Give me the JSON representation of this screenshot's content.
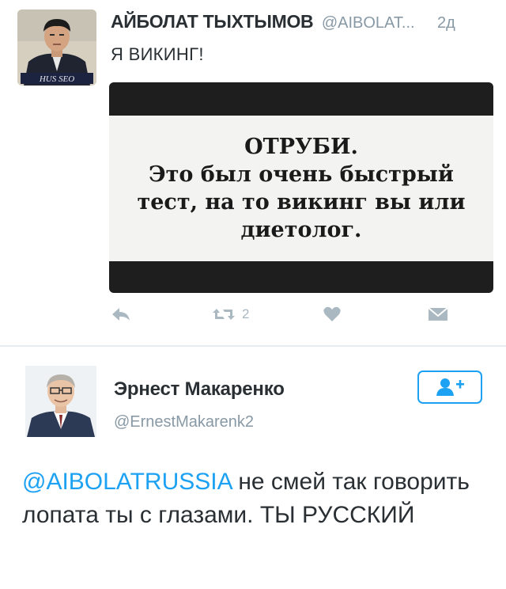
{
  "tweet1": {
    "author_name": "АЙБОЛАТ ТЫХТЫМОВ",
    "author_handle": "@AIBOLAT...",
    "time": "2д",
    "text": "Я ВИКИНГ!",
    "avatar_banner": "HUS SEO",
    "media_text": {
      "line1": "ОТРУБИ.",
      "line2": "Это был очень быстрый",
      "line3": "тест, на то викинг вы или",
      "line4": "диетолог."
    },
    "actions": {
      "reply_icon": "reply-icon",
      "retweet_icon": "retweet-icon",
      "retweet_count": "2",
      "like_icon": "heart-icon",
      "dm_icon": "envelope-icon"
    }
  },
  "tweet2": {
    "author_name": "Эрнест Макаренко",
    "author_handle": "@ErnestMakarenk2",
    "follow_icon": "add-user-icon",
    "mention": "@AIBOLATRUSSIA",
    "text": " не смей так говорить лопата ты с глазами.  ТЫ РУССКИЙ"
  },
  "colors": {
    "link_blue": "#1da1f2",
    "meta_gray": "#8899a6",
    "icon_gray": "#aab8c2",
    "text_dark": "#292f33"
  }
}
